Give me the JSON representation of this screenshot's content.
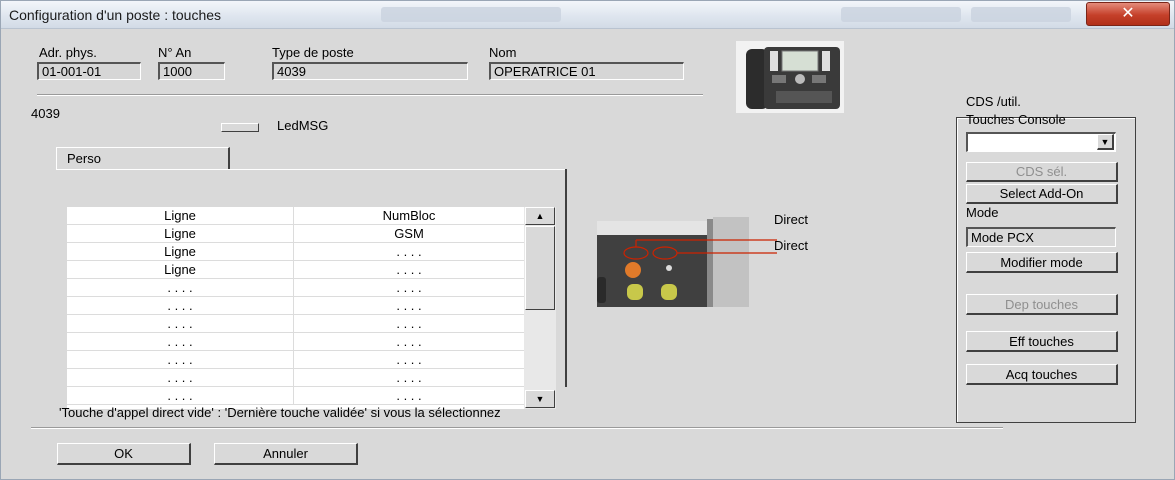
{
  "window": {
    "title": "Configuration d'un poste : touches",
    "close_label": "✕"
  },
  "header": {
    "adr_label": "Adr. phys.",
    "adr_value": "01-001-01",
    "nan_label": "N° An",
    "nan_value": "1000",
    "type_label": "Type de poste",
    "type_value": "4039",
    "nom_label": "Nom",
    "nom_value": "OPERATRICE 01"
  },
  "set_model": "4039",
  "led_label": "LedMSG",
  "tabs": [
    {
      "label": "Perso"
    }
  ],
  "grid": {
    "rows": [
      [
        "Ligne",
        "NumBloc"
      ],
      [
        "Ligne",
        "GSM"
      ],
      [
        "Ligne",
        ". . . ."
      ],
      [
        "Ligne",
        ". . . ."
      ],
      [
        ". . . .",
        ". . . ."
      ],
      [
        ". . . .",
        ". . . ."
      ],
      [
        ". . . .",
        ". . . ."
      ],
      [
        ". . . .",
        ". . . ."
      ],
      [
        ". . . .",
        ". . . ."
      ],
      [
        ". . . .",
        ". . . ."
      ],
      [
        ". . . .",
        ". . . ."
      ]
    ]
  },
  "callouts": {
    "top": "Direct",
    "bottom": "Direct"
  },
  "hint": "'Touche d'appel direct vide' : 'Dernière touche validée' si vous la sélectionnez",
  "footer": {
    "ok_label": "OK",
    "cancel_label": "Annuler"
  },
  "right_panel": {
    "cds_label": "CDS  /util.",
    "touches_label": "Touches Console",
    "combo_value": "",
    "cds_sel_label": "CDS sél.",
    "select_addon_label": "Select Add-On",
    "mode_label": "Mode",
    "mode_value": "Mode PCX",
    "modifier_mode_label": "Modifier mode",
    "dep_touches_label": "Dep touches",
    "eff_touches_label": "Eff touches",
    "acq_touches_label": "Acq touches"
  },
  "colors": {
    "titlebar": "#dfe6ef",
    "dialog_bg": "#d9d9d9",
    "close_button": "#c5402a",
    "callout_line": "#cc2200"
  }
}
